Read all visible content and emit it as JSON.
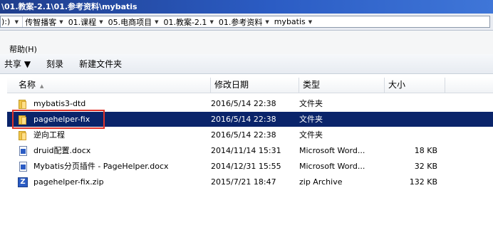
{
  "window": {
    "title": "\\01.教案-2.1\\01.参考资料\\mybatis"
  },
  "address": {
    "prefix": "):)",
    "crumbs": [
      "传智播客",
      "01.课程",
      "05.电商项目",
      "01.教案-2.1",
      "01.参考资料",
      "mybatis"
    ]
  },
  "menu": {
    "help": "帮助(H)"
  },
  "toolbar": {
    "share": "共享 ▼",
    "burn": "刻录",
    "new_folder": "新建文件夹"
  },
  "columns": {
    "name": "名称",
    "date": "修改日期",
    "type": "类型",
    "size": "大小"
  },
  "files": [
    {
      "name": "mybatis3-dtd",
      "date": "2016/5/14 22:38",
      "type": "文件夹",
      "size": "",
      "icon": "folder-icon"
    },
    {
      "name": "pagehelper-fix",
      "date": "2016/5/14 22:38",
      "type": "文件夹",
      "size": "",
      "icon": "folder-icon",
      "selected": true
    },
    {
      "name": "逆向工程",
      "date": "2016/5/14 22:38",
      "type": "文件夹",
      "size": "",
      "icon": "folder-icon"
    },
    {
      "name": "druid配置.docx",
      "date": "2014/11/14 15:31",
      "type": "Microsoft Word...",
      "size": "18 KB",
      "icon": "word-doc-icon"
    },
    {
      "name": "Mybatis分页插件 - PageHelper.docx",
      "date": "2014/12/31 15:55",
      "type": "Microsoft Word...",
      "size": "32 KB",
      "icon": "word-doc-icon"
    },
    {
      "name": "pagehelper-fix.zip",
      "date": "2015/7/21 18:47",
      "type": "zip Archive",
      "size": "132 KB",
      "icon": "zip-archive-icon"
    }
  ],
  "colors": {
    "title_bar": "#2b5cc4",
    "selection": "#0a246a",
    "annotation_box": "#e0342a"
  }
}
